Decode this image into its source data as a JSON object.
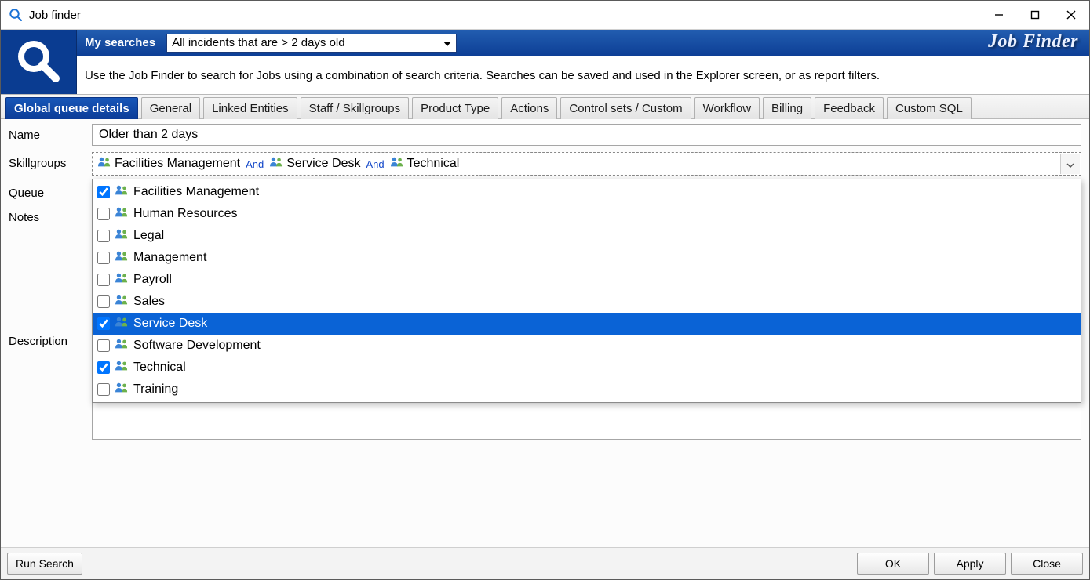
{
  "window": {
    "title": "Job finder"
  },
  "header": {
    "my_searches_label": "My searches",
    "my_searches_value": "All incidents that are > 2 days old",
    "brand": "Job Finder",
    "description": "Use the Job Finder to search for Jobs using a combination of search criteria.  Searches can be saved and used in the Explorer screen, or as report filters."
  },
  "tabs": [
    {
      "id": "global-queue-details",
      "label": "Global queue details",
      "active": true
    },
    {
      "id": "general",
      "label": "General"
    },
    {
      "id": "linked-entities",
      "label": "Linked Entities"
    },
    {
      "id": "staff-skillgroups",
      "label": "Staff / Skillgroups"
    },
    {
      "id": "product-type",
      "label": "Product Type"
    },
    {
      "id": "actions",
      "label": "Actions"
    },
    {
      "id": "control-sets-custom",
      "label": "Control sets / Custom"
    },
    {
      "id": "workflow",
      "label": "Workflow"
    },
    {
      "id": "billing",
      "label": "Billing"
    },
    {
      "id": "feedback",
      "label": "Feedback"
    },
    {
      "id": "custom-sql",
      "label": "Custom SQL"
    }
  ],
  "form": {
    "labels": {
      "name": "Name",
      "skillgroups": "Skillgroups",
      "queue": "Queue",
      "notes": "Notes",
      "description": "Description"
    },
    "name_value": "Older than 2 days",
    "skillgroups_selected_display": {
      "and": "And",
      "items": [
        "Facilities Management",
        "Service Desk",
        "Technical"
      ]
    },
    "skillgroups_options": [
      {
        "label": "Facilities Management",
        "checked": true,
        "highlight": false
      },
      {
        "label": "Human Resources",
        "checked": false,
        "highlight": false
      },
      {
        "label": "Legal",
        "checked": false,
        "highlight": false
      },
      {
        "label": "Management",
        "checked": false,
        "highlight": false
      },
      {
        "label": "Payroll",
        "checked": false,
        "highlight": false
      },
      {
        "label": "Sales",
        "checked": false,
        "highlight": false
      },
      {
        "label": "Service Desk",
        "checked": true,
        "highlight": true
      },
      {
        "label": "Software Development",
        "checked": false,
        "highlight": false
      },
      {
        "label": "Technical",
        "checked": true,
        "highlight": false
      },
      {
        "label": "Training",
        "checked": false,
        "highlight": false
      }
    ]
  },
  "footer": {
    "run_search": "Run Search",
    "ok": "OK",
    "apply": "Apply",
    "close": "Close"
  }
}
